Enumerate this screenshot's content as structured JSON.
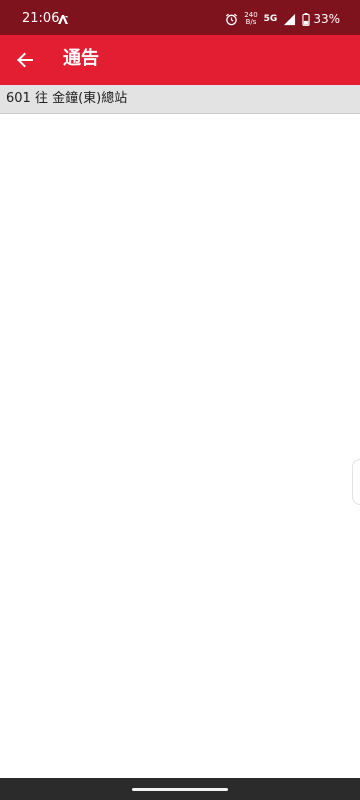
{
  "status_bar": {
    "time": "21:06",
    "net_speed_value": "240",
    "net_speed_unit": "B/s",
    "network_type": "5G",
    "battery_percent": "33%",
    "icons": [
      "notification-app-icon",
      "alarm-icon",
      "signal-icon",
      "battery-icon"
    ]
  },
  "app_bar": {
    "title": "通告",
    "back_icon": "arrow-left-icon",
    "color": "#e31d32"
  },
  "route": {
    "label": "601 往 金鐘(東)總站"
  },
  "colors": {
    "status_bar": "#7e121d",
    "app_bar": "#e31d32",
    "route_header": "#e3e3e3",
    "nav_bar": "#2b2b2b"
  }
}
